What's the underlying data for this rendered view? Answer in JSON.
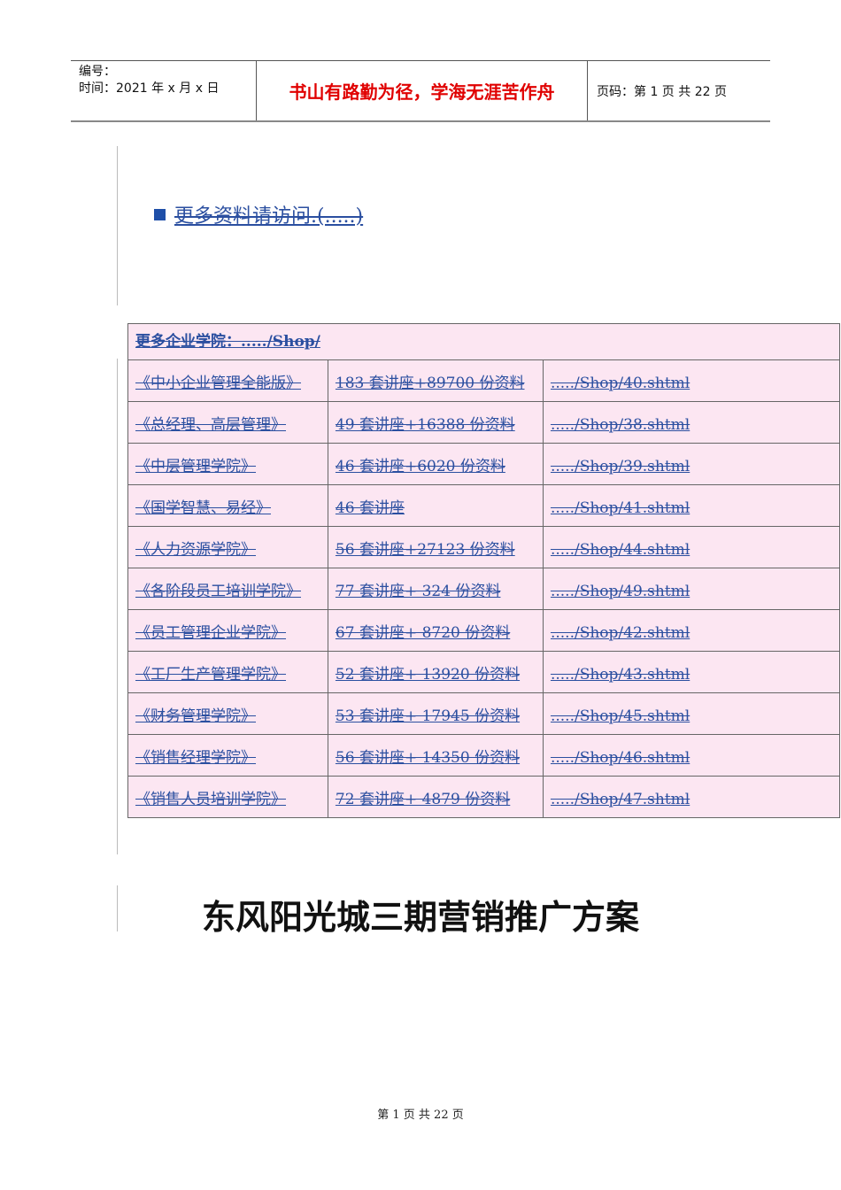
{
  "header": {
    "number_label": "编号：",
    "time_label": "时间：2021 年 x 月 x 日",
    "motto": "书山有路勤为径，学海无涯苦作舟",
    "page_label": "页码：第 1 页  共 22 页"
  },
  "more_link": "更多资料请访问.(.....)",
  "table": {
    "header": "更多企业学院：...../Shop/",
    "rows": [
      [
        "《中小企业管理全能版》",
        "183 套讲座+89700 份资料",
        "...../Shop/40.shtml"
      ],
      [
        "《总经理、高层管理》",
        "49 套讲座+16388 份资料",
        "...../Shop/38.shtml"
      ],
      [
        "《中层管理学院》",
        "46 套讲座+6020 份资料",
        "...../Shop/39.shtml"
      ],
      [
        "《国学智慧、易经》",
        "46 套讲座",
        "...../Shop/41.shtml"
      ],
      [
        "《人力资源学院》",
        "56 套讲座+27123 份资料",
        "...../Shop/44.shtml"
      ],
      [
        "《各阶段员工培训学院》",
        "77 套讲座+ 324 份资料",
        "...../Shop/49.shtml"
      ],
      [
        "《员工管理企业学院》",
        "67 套讲座+ 8720 份资料",
        "...../Shop/42.shtml"
      ],
      [
        "《工厂生产管理学院》",
        "52 套讲座+ 13920 份资料",
        "...../Shop/43.shtml"
      ],
      [
        "《财务管理学院》",
        "53 套讲座+ 17945 份资料",
        "...../Shop/45.shtml"
      ],
      [
        "《销售经理学院》",
        "56 套讲座+ 14350 份资料",
        "...../Shop/46.shtml"
      ],
      [
        "《销售人员培训学院》",
        "72 套讲座+ 4879 份资料",
        "...../Shop/47.shtml"
      ]
    ]
  },
  "doc_title": "东风阳光城三期营销推广方案",
  "footer": "第 1 页 共 22 页"
}
